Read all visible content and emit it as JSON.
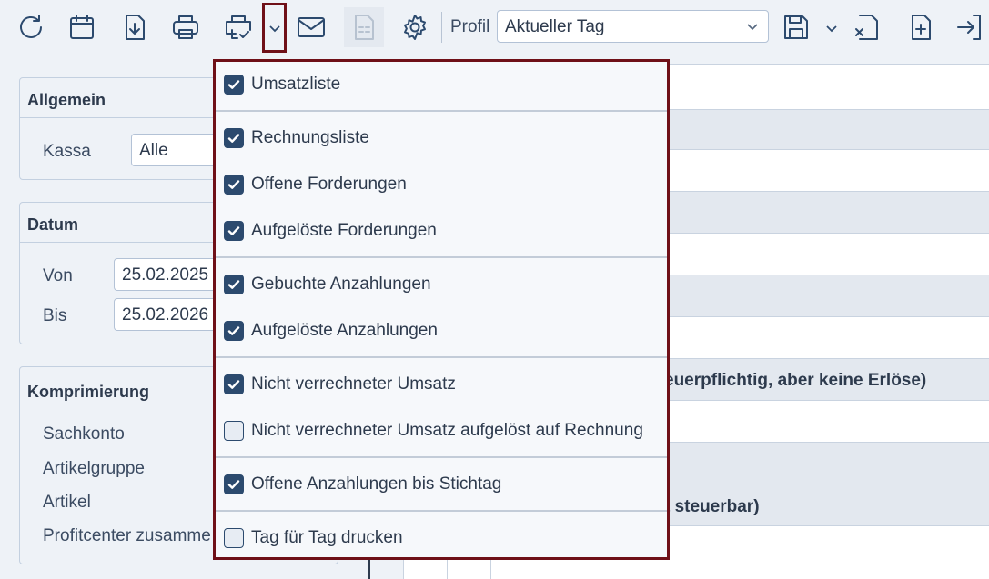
{
  "toolbar": {
    "icons": [
      "refresh-icon",
      "calendar-icon",
      "download-icon",
      "print-icon",
      "print-options-icon",
      "chevron-down-icon",
      "mail-icon",
      "document-icon",
      "gear-icon",
      "save-icon",
      "file-close-icon",
      "file-add-icon",
      "export-icon"
    ],
    "profil_label": "Profil",
    "profil_value": "Aktueller Tag"
  },
  "allgemein": {
    "title": "Allgemein",
    "kassa_label": "Kassa",
    "kassa_value": "Alle"
  },
  "datum": {
    "title": "Datum",
    "von_label": "Von",
    "von_value": "25.02.2025",
    "bis_label": "Bis",
    "bis_value": "25.02.2026"
  },
  "komprimierung": {
    "title": "Komprimierung",
    "items": [
      "Sachkonto",
      "Artikelgruppe",
      "Artikel",
      "Profitcenter zusamme"
    ]
  },
  "background_rows": {
    "row1": "euerpflichtig, aber keine Erlöse)",
    "row2": "t steuerbar)"
  },
  "menu": {
    "items": [
      {
        "label": "Umsatzliste",
        "checked": true
      },
      {
        "label": "Rechnungsliste",
        "checked": true
      },
      {
        "label": "Offene Forderungen",
        "checked": true
      },
      {
        "label": "Aufgelöste Forderungen",
        "checked": true
      },
      {
        "label": "Gebuchte Anzahlungen",
        "checked": true
      },
      {
        "label": "Aufgelöste Anzahlungen",
        "checked": true
      },
      {
        "label": "Nicht verrechneter Umsatz",
        "checked": true
      },
      {
        "label": "Nicht verrechneter Umsatz aufgelöst auf Rechnung",
        "checked": false
      },
      {
        "label": "Offene Anzahlungen bis Stichtag",
        "checked": true
      },
      {
        "label": "Tag für Tag drucken",
        "checked": false
      }
    ]
  },
  "colors": {
    "accent": "#2c4a6e",
    "highlight_border": "#6f1018",
    "background": "#eef2f7"
  }
}
